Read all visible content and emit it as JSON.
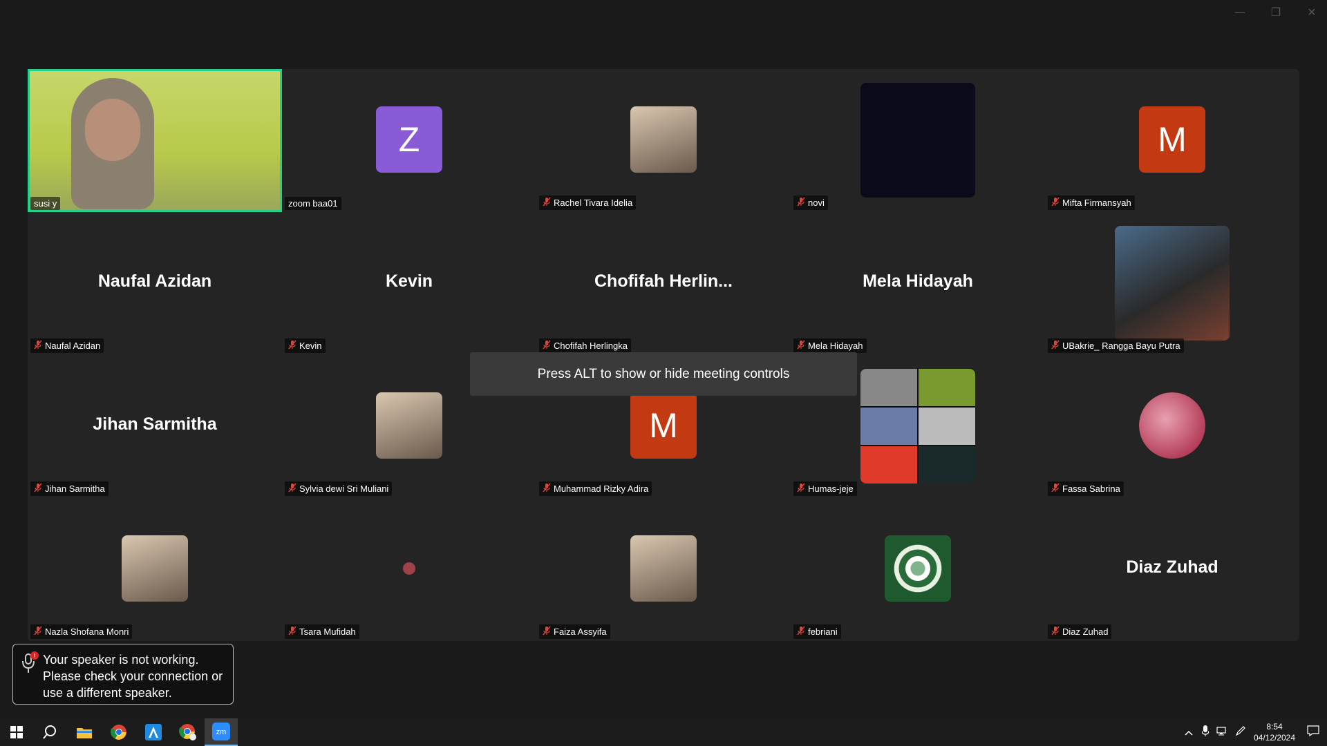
{
  "window": {
    "minimize": "—",
    "restore": "❐",
    "close": "✕"
  },
  "gallery": {
    "participants": [
      {
        "name": "susi y",
        "muted": false,
        "display": "video",
        "active": true
      },
      {
        "name": "zoom baa01",
        "muted": false,
        "display": "initial",
        "initial": "Z",
        "color": "#8a5bd6"
      },
      {
        "name": "Rachel Tivara Idelia",
        "muted": true,
        "display": "photo"
      },
      {
        "name": "novi",
        "muted": true,
        "display": "photo-dark"
      },
      {
        "name": "Mifta Firmansyah",
        "muted": true,
        "display": "initial",
        "initial": "M",
        "color": "#c33a12"
      },
      {
        "name": "Naufal Azidan",
        "muted": true,
        "display": "name",
        "big_name": "Naufal Azidan"
      },
      {
        "name": "Kevin",
        "muted": true,
        "display": "name",
        "big_name": "Kevin"
      },
      {
        "name": "Chofifah Herlingka",
        "muted": true,
        "display": "name",
        "big_name": "Chofifah  Herlin..."
      },
      {
        "name": "Mela Hidayah",
        "muted": true,
        "display": "name",
        "big_name": "Mela Hidayah"
      },
      {
        "name": "UBakrie_ Rangga Bayu Putra",
        "muted": true,
        "display": "photo-big"
      },
      {
        "name": "Jihan Sarmitha",
        "muted": true,
        "display": "name",
        "big_name": "Jihan Sarmitha"
      },
      {
        "name": "Sylvia dewi Sri Muliani",
        "muted": true,
        "display": "photo"
      },
      {
        "name": "Muhammad Rizky Adira",
        "muted": true,
        "display": "initial",
        "initial": "M",
        "color": "#c33a12"
      },
      {
        "name": "Humas-jeje",
        "muted": true,
        "display": "photo-collage"
      },
      {
        "name": "Fassa Sabrina",
        "muted": true,
        "display": "photo-circle"
      },
      {
        "name": "Nazla Shofana Monri",
        "muted": true,
        "display": "photo"
      },
      {
        "name": "Tsara Mufidah",
        "muted": true,
        "display": "dot"
      },
      {
        "name": "Faiza Assyifa",
        "muted": true,
        "display": "photo"
      },
      {
        "name": "febriani",
        "muted": true,
        "display": "photo-heart"
      },
      {
        "name": "Diaz Zuhad",
        "muted": true,
        "display": "name",
        "big_name": "Diaz Zuhad"
      }
    ]
  },
  "toast": {
    "text": "Press ALT to show or hide meeting controls"
  },
  "speaker_alert": {
    "text": "Your speaker is not working. Please check your connection or use a different speaker.",
    "badge": "!"
  },
  "taskbar": {
    "apps": [
      "windows-start",
      "search",
      "file-explorer",
      "chrome",
      "app-a",
      "chrome-profile",
      "zoom"
    ],
    "clock": {
      "time": "8:54",
      "date": "04/12/2024"
    }
  }
}
